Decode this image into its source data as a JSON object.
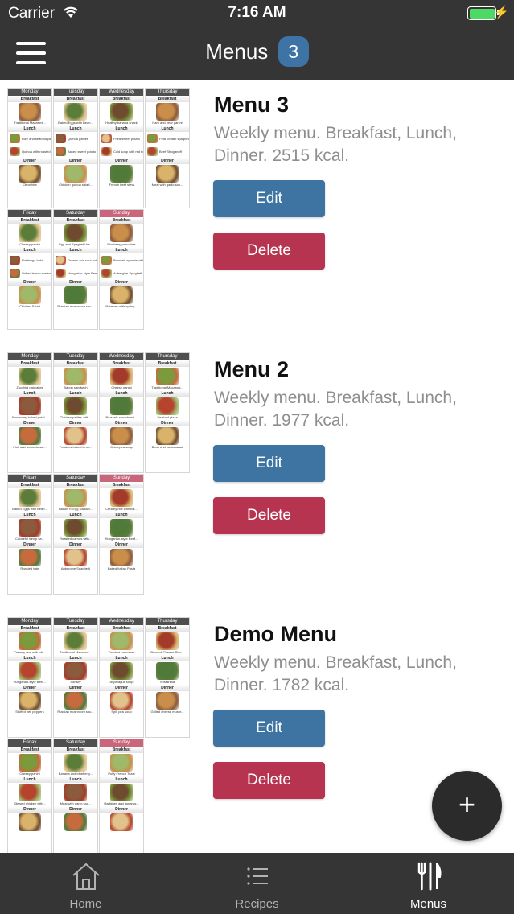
{
  "status_bar": {
    "carrier": "Carrier",
    "time": "7:16 AM",
    "battery_level": 1.0
  },
  "nav": {
    "title": "Menus",
    "badge": "3"
  },
  "menus": [
    {
      "title": "Menu 3",
      "description": "Weekly menu. Breakfast, Lunch, Dinner. 2515 kcal.",
      "edit_label": "Edit",
      "delete_label": "Delete",
      "days": [
        {
          "day": "Monday",
          "breakfast": "Traditional Macaroni...",
          "lunch": [
            "Rice and seafood pilaf",
            "Quinoa with roasted vegetables"
          ],
          "dinner": "Okroshka"
        },
        {
          "day": "Tuesday",
          "breakfast": "Baked Eggs with Bean...",
          "lunch": [
            "Quinoa patties",
            "Baked sweet potato"
          ],
          "dinner": "Chicken quinoa salad..."
        },
        {
          "day": "Wednesday",
          "breakfast": "Healthy banana snack",
          "lunch": [
            "Fried sweet potato",
            "Cold soup with red beet"
          ],
          "dinner": "French beef stew"
        },
        {
          "day": "Thursday",
          "breakfast": "Ham and pear panini",
          "lunch": [
            "Feta tomato spaghetti",
            "Beef Stroganoff"
          ],
          "dinner": "Meat with garlic sau..."
        },
        {
          "day": "Friday",
          "breakfast": "Cheesy panini",
          "lunch": [
            "Rutabaga bake",
            "Grilled lemon marinated pork"
          ],
          "dinner": "Chicken Salad"
        },
        {
          "day": "Saturday",
          "breakfast": "Egg and Spaghetti ba...",
          "lunch": [
            "Greens and sour potato salad",
            "Hungarian-style Beef Stew"
          ],
          "dinner": "Russian mushroom sou..."
        },
        {
          "day": "Sunday",
          "breakfast": "Blueberry pancakes",
          "lunch": [
            "Brussels sprouts with bacon",
            "Aubergine Spaghetti"
          ],
          "dinner": "Potatoes with spring..."
        }
      ]
    },
    {
      "title": "Menu 2",
      "description": "Weekly menu. Breakfast, Lunch, Dinner. 1977 kcal.",
      "edit_label": "Edit",
      "delete_label": "Delete",
      "days": [
        {
          "day": "Monday",
          "breakfast": "Zucchini pancakes",
          "lunch": [
            "Rosemary-baked potat..."
          ],
          "dinner": "Fish and avocado sal..."
        },
        {
          "day": "Tuesday",
          "breakfast": "Bacon sandwich",
          "lunch": [
            "Chicken patties with..."
          ],
          "dinner": "Potatoes baked in so..."
        },
        {
          "day": "Wednesday",
          "breakfast": "Cheesy panini",
          "lunch": [
            "Brussels sprouts wit..."
          ],
          "dinner": "Chick-pea soup"
        },
        {
          "day": "Thursday",
          "breakfast": "Traditional Macaroni...",
          "lunch": [
            "Seafood pizza"
          ],
          "dinner": "Bean and pasta salad"
        },
        {
          "day": "Friday",
          "breakfast": "Baked Eggs with Bean...",
          "lunch": [
            "Colourful turnip sa..."
          ],
          "dinner": "Roasted kale"
        },
        {
          "day": "Saturday",
          "breakfast": "Bacon 'n' Egg Sandwi...",
          "lunch": [
            "Roasted carrots with..."
          ],
          "dinner": "Aubergine Spaghetti"
        },
        {
          "day": "Sunday",
          "breakfast": "Creamy rice with tok...",
          "lunch": [
            "Hungarian-style Beef..."
          ],
          "dinner": "Baked Italian Pasta"
        }
      ]
    },
    {
      "title": "Demo Menu",
      "description": "Weekly menu. Breakfast, Lunch, Dinner. 1782 kcal.",
      "edit_label": "Edit",
      "delete_label": "Delete",
      "days": [
        {
          "day": "Monday",
          "breakfast": "Creamy rice with tok...",
          "lunch": [
            "Hungarian-style Beef..."
          ],
          "dinner": "Stuffed bell peppers"
        },
        {
          "day": "Tuesday",
          "breakfast": "Traditional Macaroni...",
          "lunch": [
            "Ironsky"
          ],
          "dinner": "Russian mushroom sou..."
        },
        {
          "day": "Wednesday",
          "breakfast": "Zucchini pancakes",
          "lunch": [
            "Asparagus soup"
          ],
          "dinner": "Split pea soup"
        },
        {
          "day": "Thursday",
          "breakfast": "Broccoli Cheese Pico...",
          "lunch": [
            "Shrashma"
          ],
          "dinner": "Grilled cheese mushr..."
        },
        {
          "day": "Friday",
          "breakfast": "Cheesy panini",
          "lunch": [
            "Stewed chicken with..."
          ],
          "dinner": ""
        },
        {
          "day": "Saturday",
          "breakfast": "Banana and blueberry...",
          "lunch": [
            "Meat with garlic sau..."
          ],
          "dinner": ""
        },
        {
          "day": "Sunday",
          "breakfast": "Puffy French Toast",
          "lunch": [
            "Radishes and asparag..."
          ],
          "dinner": ""
        }
      ]
    }
  ],
  "labels": {
    "breakfast": "Breakfast",
    "lunch": "Lunch",
    "dinner": "Dinner"
  },
  "fab": {
    "label": "+"
  },
  "tabs": [
    {
      "label": "Home",
      "icon": "home-icon",
      "active": false
    },
    {
      "label": "Recipes",
      "icon": "list-icon",
      "active": false
    },
    {
      "label": "Menus",
      "icon": "fork-knife-icon",
      "active": true
    }
  ],
  "colors": {
    "bar": "#353535",
    "accent": "#3d74a2",
    "danger": "#b73451",
    "sunday": "#c9667c"
  }
}
